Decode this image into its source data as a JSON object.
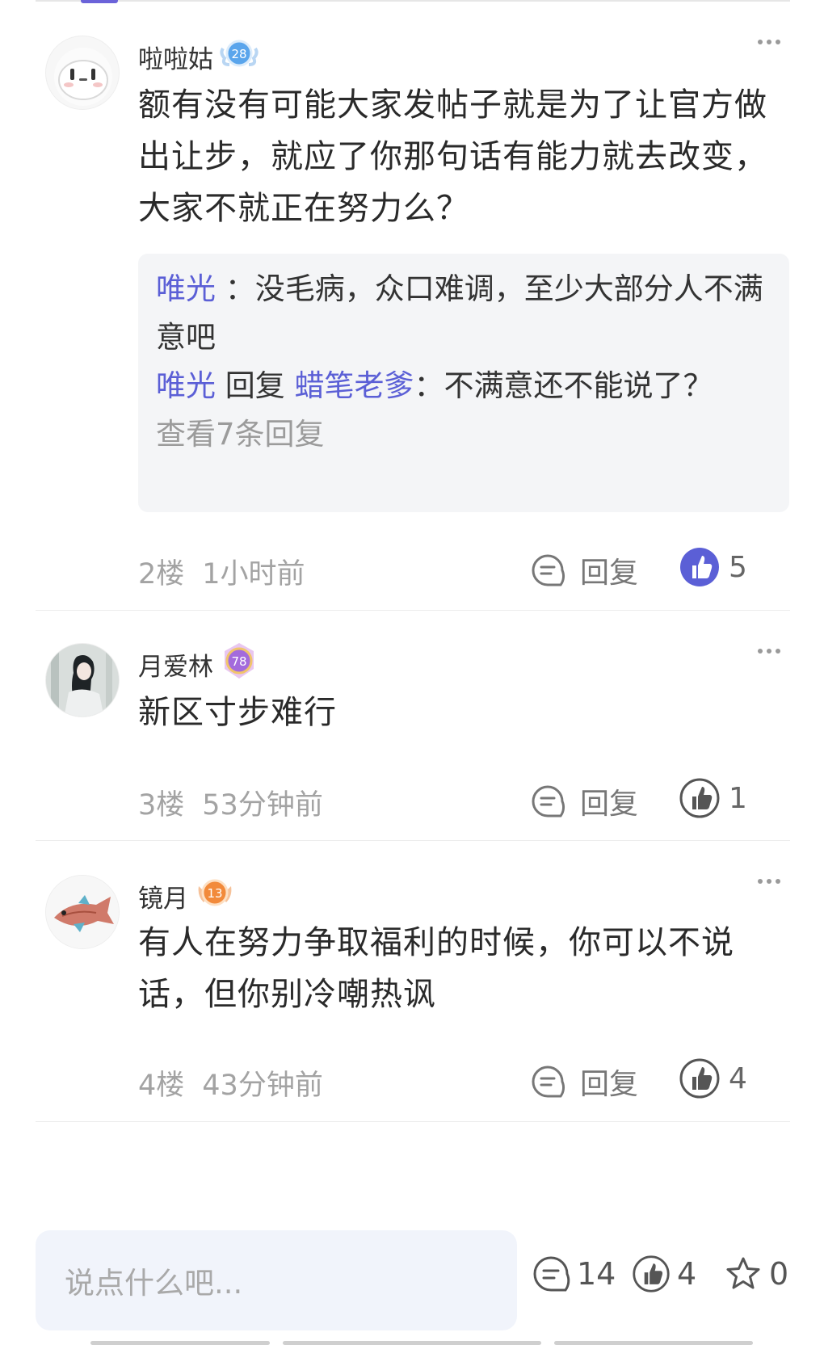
{
  "colors": {
    "accent": "#5b5fd6",
    "meta": "#a3a3a3",
    "reply_bg": "#f4f5f7",
    "liked": "#5b5fd6"
  },
  "comments": [
    {
      "username": "啦啦姑",
      "level": "28",
      "content": "额有没有可能大家发帖子就是为了让官方做出让步，就应了你那句话有能力就去改变，大家不就正在努力么？",
      "replies": [
        {
          "who": "唯光",
          "sep": "：",
          "text": "没毛病，众口难调，至少大部分人不满意吧"
        },
        {
          "who": "唯光",
          "verb": "回复",
          "target": "蜡笔老爹",
          "sep": "：",
          "text": "不满意还不能说了？"
        }
      ],
      "view_more": "查看7条回复",
      "floor": "2楼",
      "time": "1小时前",
      "reply_label": "回复",
      "likes": "5"
    },
    {
      "username": "月爱林",
      "level": "78",
      "content": "新区寸步难行",
      "floor": "3楼",
      "time": "53分钟前",
      "reply_label": "回复",
      "likes": "1"
    },
    {
      "username": "镜月",
      "level": "13",
      "content": "有人在努力争取福利的时候，你可以不说话，但你别冷嘲热讽",
      "floor": "4楼",
      "time": "43分钟前",
      "reply_label": "回复",
      "likes": "4"
    }
  ],
  "bottom": {
    "placeholder": "说点什么吧...",
    "comments_count": "14",
    "likes_count": "4",
    "favorites_count": "0"
  }
}
